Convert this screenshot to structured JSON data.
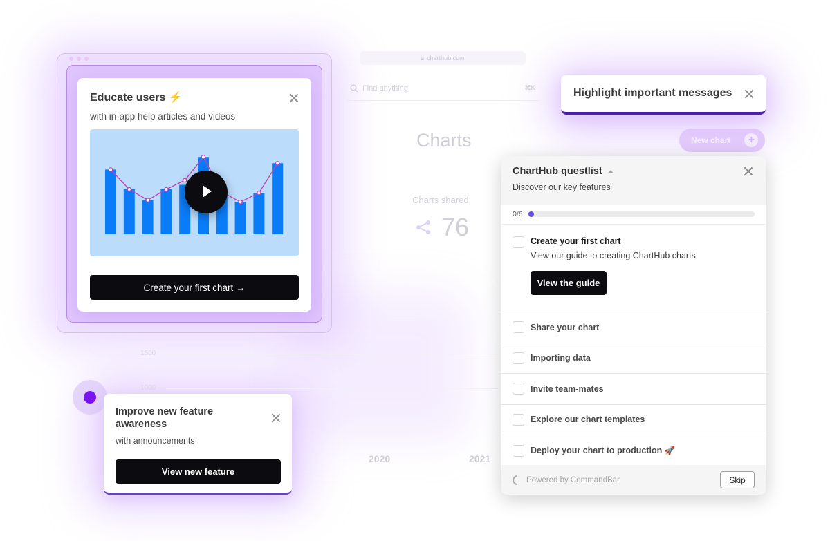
{
  "background_app": {
    "url": "charthub.com",
    "search_placeholder": "Find anything",
    "search_shortcut": "⌘K",
    "page_title": "Charts",
    "new_chart_label": "New chart",
    "stat_label": "Charts shared",
    "stat_value": "76",
    "axis_labels": [
      "1500",
      "1000"
    ],
    "year_labels": [
      "2020",
      "2021"
    ]
  },
  "educate_card": {
    "title": "Educate users",
    "title_emoji": "⚡",
    "subtitle": "with in-app help articles and videos",
    "button_label": "Create your first chart →",
    "video_chart": {
      "bars": [
        0.72,
        0.5,
        0.38,
        0.5,
        0.55,
        0.86,
        0.47,
        0.36,
        0.46,
        0.79
      ],
      "line": [
        0.72,
        0.5,
        0.38,
        0.5,
        0.6,
        0.86,
        0.47,
        0.36,
        0.46,
        0.79
      ],
      "bar_color": "#0b7cf7",
      "line_color": "#c43fb3",
      "bg_color": "#bcdcfb"
    }
  },
  "highlight_card": {
    "title": "Highlight important messages"
  },
  "announcement_card": {
    "title": "Improve new feature awareness",
    "subtitle": "with announcements",
    "button_label": "View new feature"
  },
  "questlist": {
    "title": "ChartHub questlist",
    "subtitle": "Discover our key features",
    "progress_label": "0/6",
    "progress_fraction": 0,
    "items": [
      {
        "label": "Create your first chart",
        "description": "View our guide to creating ChartHub charts",
        "button_label": "View the guide",
        "checked": false
      },
      {
        "label": "Share your chart",
        "checked": false
      },
      {
        "label": "Importing data",
        "checked": false
      },
      {
        "label": "Invite team-mates",
        "checked": false
      },
      {
        "label": "Explore our chart templates",
        "checked": false
      },
      {
        "label": "Deploy your chart to production 🚀",
        "checked": false
      }
    ],
    "footer_text": "Powered by CommandBar",
    "skip_label": "Skip"
  },
  "colors": {
    "accent_purple": "#7a14f0",
    "progress_fill": "#6a4fe4",
    "highlight_border": "#4c1fb0"
  }
}
